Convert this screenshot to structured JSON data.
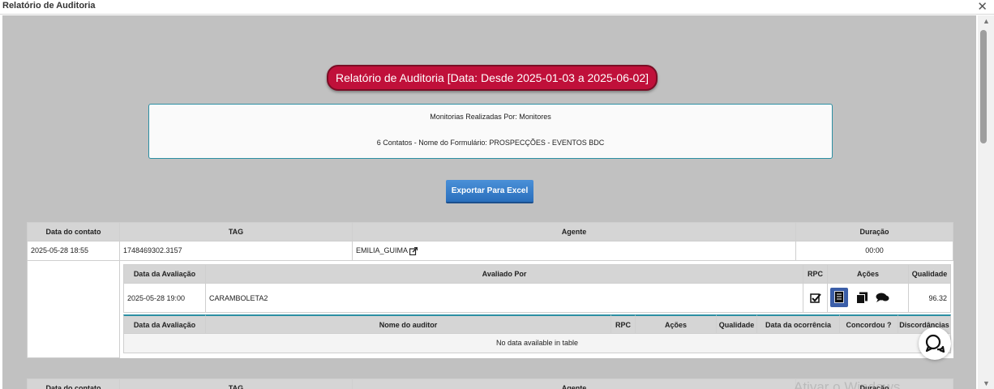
{
  "window": {
    "title": "Relatório de Auditoria",
    "close_glyph": "✕"
  },
  "report": {
    "title": "Relatório de Auditoria [Data: Desde 2025-01-03 a 2025-06-02]",
    "subtitle": "Monitorias Realizadas Por: Monitores",
    "summary": "6 Contatos - Nome do Formulário: PROSPECÇÕES - EVENTOS BDC",
    "export_label": "Exportar Para Excel"
  },
  "contacts_table": {
    "headers": {
      "date": "Data do contato",
      "tag": "TAG",
      "agent": "Agente",
      "duration": "Duração"
    },
    "rows": [
      {
        "date": "2025-05-28 18:55",
        "tag": "1748469302.3157",
        "agent": "EMILIA_GUIMA",
        "duration": "00:00"
      }
    ]
  },
  "evaluations_table": {
    "headers": {
      "date": "Data da Avaliação",
      "evaluator": "Avaliado Por",
      "rpc": "RPC",
      "actions": "Ações",
      "quality": "Qualidade"
    },
    "rows": [
      {
        "date": "2025-05-28 19:00",
        "evaluator": "CARAMBOLETA2",
        "quality": "96.32"
      }
    ],
    "action_icons": [
      "document-icon",
      "copy-icon",
      "comments-icon"
    ],
    "rpc_icon": "checkbox-checked-icon"
  },
  "audits_table": {
    "headers": {
      "date": "Data da Avaliação",
      "auditor": "Nome do auditor",
      "rpc": "RPC",
      "actions": "Ações",
      "quality": "Qualidade",
      "occurrence": "Data da ocorrência",
      "agreed": "Concordou ?",
      "disagreements": "Discordâncias"
    },
    "empty_message": "No data available in table"
  },
  "next_contacts_table": {
    "headers": {
      "date": "Data do contato",
      "tag": "TAG",
      "agent": "Agente",
      "duration": "Duração"
    }
  },
  "watermark": "Ativar o Windows",
  "colors": {
    "title_bg": "#c0103a",
    "export_bg": "#2a6fbd",
    "active_action_bg": "#3b5ea8"
  }
}
